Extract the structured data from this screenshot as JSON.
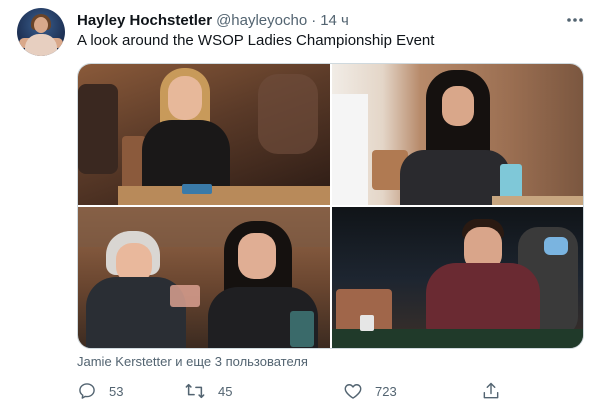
{
  "author": {
    "display_name": "Hayley Hochstetler",
    "handle": "@hayleyocho",
    "separator": "·",
    "time": "14 ч"
  },
  "tweet": {
    "text": "A look around the WSOP Ladies Championship Event"
  },
  "media": {
    "count": 4,
    "tagged_people": "Jamie Kerstetter и еще 3 пользователя"
  },
  "actions": {
    "replies": "53",
    "retweets": "45",
    "likes": "723"
  },
  "icons": {
    "more": "more-dots-icon",
    "reply": "reply-icon",
    "retweet": "retweet-icon",
    "like": "heart-icon",
    "share": "share-icon"
  },
  "colors": {
    "text_primary": "#0f1419",
    "text_secondary": "#536471",
    "border": "#cfd9de"
  }
}
